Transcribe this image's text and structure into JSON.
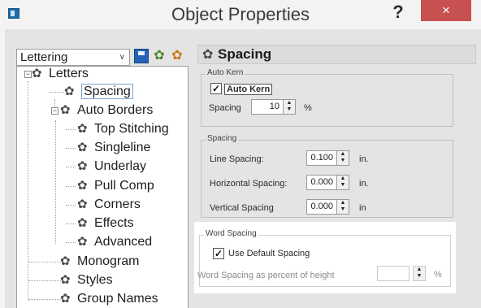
{
  "window": {
    "title": "Object Properties",
    "help_glyph": "?",
    "close_glyph": "×"
  },
  "toolbar": {
    "dropdown_value": "Lettering",
    "dropdown_arrow": "∨"
  },
  "tree": {
    "root_label": "Letters",
    "items": {
      "spacing": "Spacing",
      "auto_borders": "Auto Borders",
      "top_stitching": "Top Stitching",
      "singleline": "Singleline",
      "underlay": "Underlay",
      "pull_comp": "Pull Comp",
      "corners": "Corners",
      "effects": "Effects",
      "advanced": "Advanced",
      "monogram": "Monogram",
      "styles": "Styles",
      "group_names": "Group Names"
    }
  },
  "panel": {
    "title": "Spacing",
    "auto_kern_group": {
      "label": "Auto Kern",
      "checkbox_label": "Auto Kern",
      "checked": true,
      "spacing_label": "Spacing",
      "spacing_value": "10",
      "spacing_unit": "%"
    },
    "spacing_group": {
      "label": "Spacing",
      "line_spacing_label": "Line Spacing:",
      "line_spacing_value": "0.100",
      "line_spacing_unit": "in.",
      "horizontal_spacing_label": "Horizontal Spacing:",
      "horizontal_spacing_value": "0.000",
      "horizontal_spacing_unit": "in.",
      "vertical_spacing_label": "Vertical Spacing",
      "vertical_spacing_value": "0.000",
      "vertical_spacing_unit": "in"
    },
    "word_spacing_group": {
      "label": "Word Spacing",
      "checkbox_label": "Use Default Spacing",
      "checked": true,
      "percent_label": "Word Spacing as percent of height",
      "percent_value": "",
      "percent_unit": "%"
    }
  },
  "colors": {
    "close_button": "#c75050",
    "dialog_background": "#e4e4e4"
  }
}
